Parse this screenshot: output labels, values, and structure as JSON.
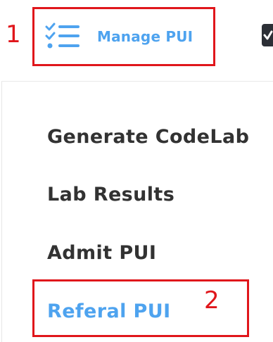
{
  "nav": {
    "manage_pui_label": "Manage PUI",
    "icon": "checklist-icon",
    "next_icon": "clipboard-icon"
  },
  "menu": {
    "items": [
      {
        "label": "Generate CodeLab",
        "active": false
      },
      {
        "label": "Lab Results",
        "active": false
      },
      {
        "label": "Admit PUI",
        "active": false
      },
      {
        "label": "Referal PUI",
        "active": true
      }
    ]
  },
  "annotations": {
    "first": "1",
    "second": "2"
  },
  "colors": {
    "accent": "#4ea3ef",
    "annotation": "#e0161b",
    "text": "#323232"
  }
}
